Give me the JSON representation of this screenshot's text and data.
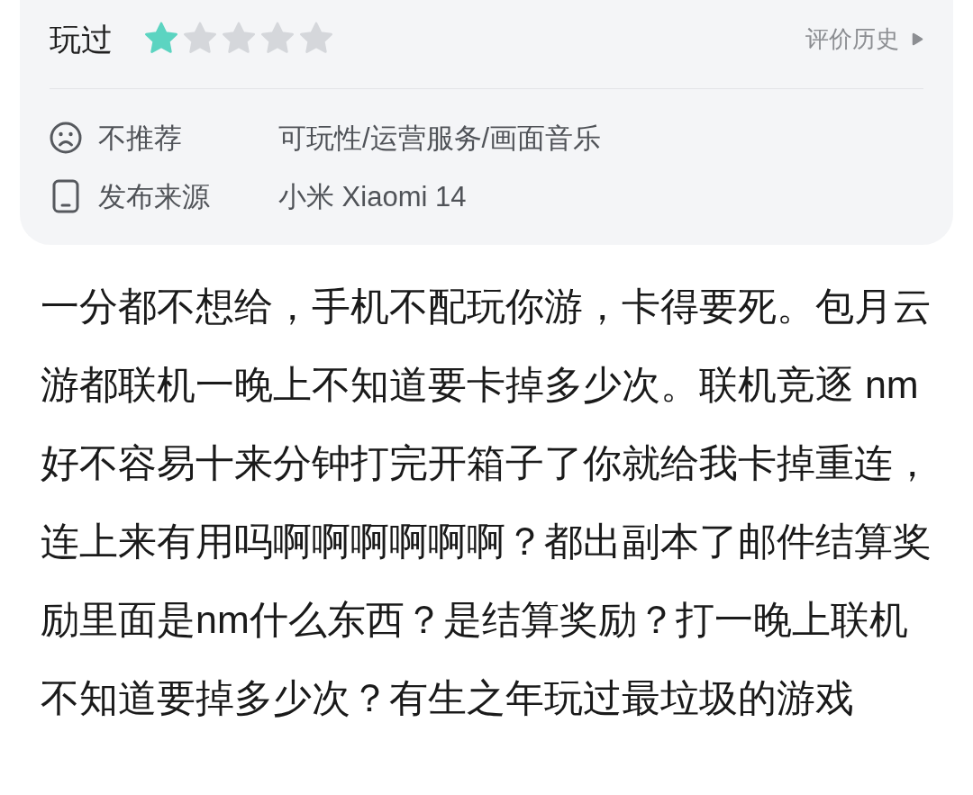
{
  "rating_card": {
    "status": "玩过",
    "stars": 1,
    "history_link": {
      "label": "评价历史"
    },
    "details": [
      {
        "kind": "recommendation",
        "label": "不推荐",
        "value": "可玩性/运营服务/画面音乐"
      },
      {
        "kind": "source",
        "label": "发布来源",
        "value": "小米 Xiaomi 14"
      }
    ]
  },
  "review_text": "一分都不想给，手机不配玩你游，卡得要死。包月云游都联机一晚上不知道要卡掉多少次。联机竞逐 nm好不容易十来分钟打完开箱子了你就给我卡掉重连，连上来有用吗啊啊啊啊啊啊？都出副本了邮件结算奖励里面是nm什么东西？是结算奖励？打一晚上联机不知道要掉多少次？有生之年玩过最垃圾的游戏"
}
